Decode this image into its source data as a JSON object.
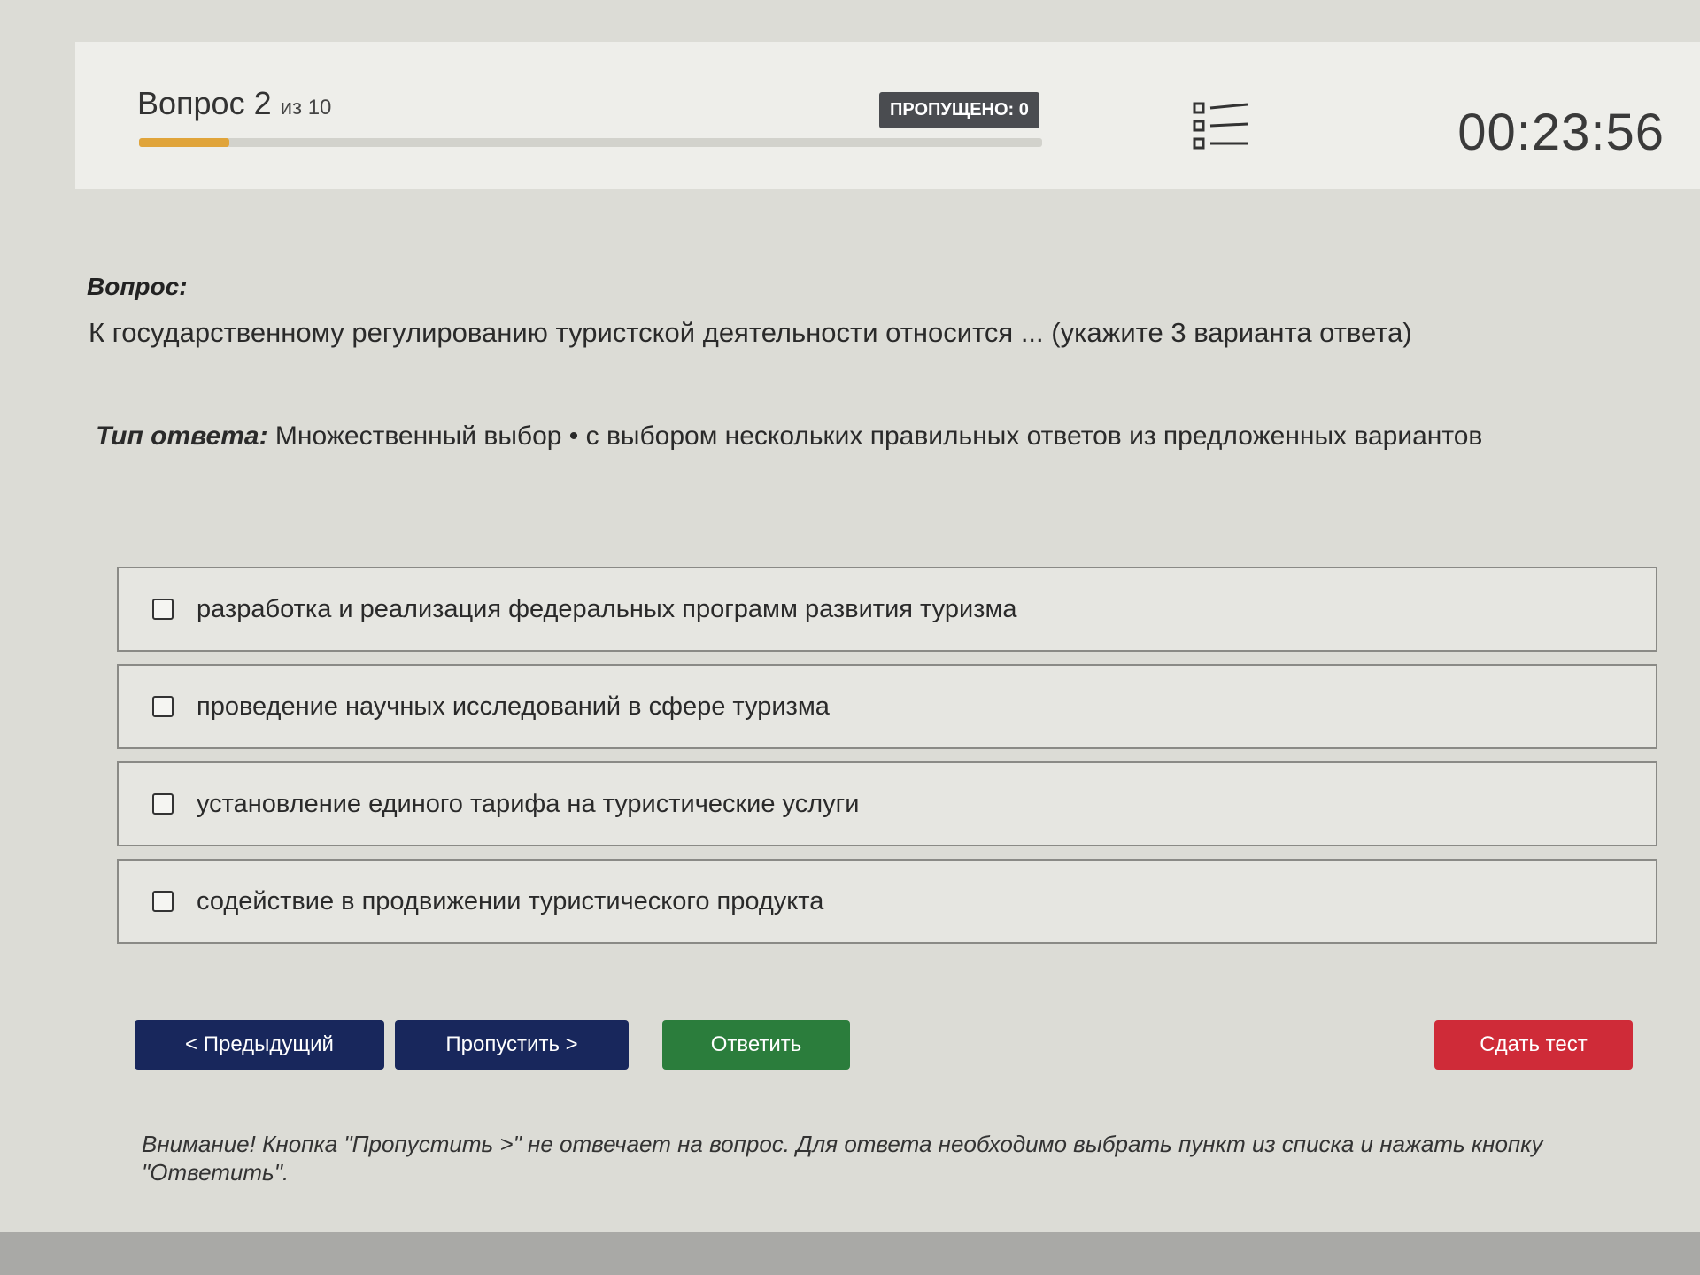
{
  "header": {
    "question_label": "Вопрос 2",
    "question_of": "из 10",
    "progress_fraction": 0.1,
    "skipped_badge": "ПРОПУЩЕНО: 0",
    "list_icon": "question-list-icon",
    "timer": "00:23:56"
  },
  "question": {
    "heading": "Вопрос:",
    "text": "К государственному регулированию туристской деятельности относится ... (укажите 3 варианта ответа)"
  },
  "answer_type": {
    "label": "Тип ответа:",
    "value": "Множественный выбор • с выбором нескольких правильных ответов из предложенных вариантов"
  },
  "options": [
    {
      "label": "разработка и реализация федеральных программ развития туризма",
      "checked": false
    },
    {
      "label": "проведение научных исследований в сфере туризма",
      "checked": false
    },
    {
      "label": "установление единого тарифа на туристические услуги",
      "checked": false
    },
    {
      "label": "содействие в продвижении туристического продукта",
      "checked": false
    }
  ],
  "buttons": {
    "prev": "< Предыдущий",
    "skip": "Пропустить >",
    "answer": "Ответить",
    "submit": "Сдать тест"
  },
  "notice": "Внимание! Кнопка \"Пропустить >\" не отвечает на вопрос. Для ответа необходимо выбрать пункт из списка и нажать кнопку \"Ответить\".",
  "colors": {
    "progress": "#e0a43a",
    "nav_button": "#18275c",
    "answer_button": "#2b7d3c",
    "submit_button": "#cf2b38",
    "badge": "#4a4c50"
  }
}
